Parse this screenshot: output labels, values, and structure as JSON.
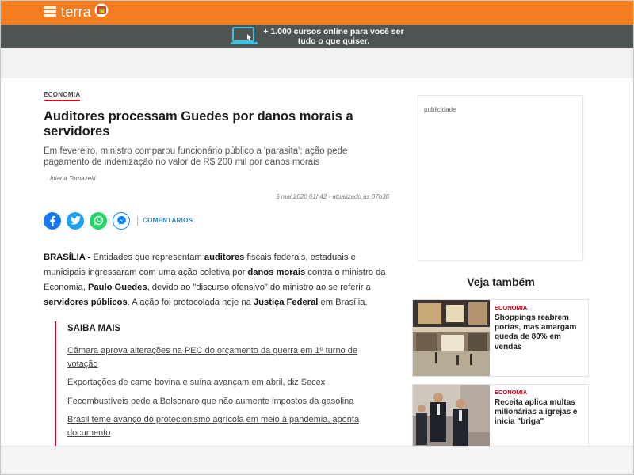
{
  "header": {
    "logo_text": "terra",
    "menu_icon": "hamburger-menu-icon",
    "brand_color": "#f47d20"
  },
  "promo": {
    "icon": "laptop-icon",
    "text_line1": "+ 1.000 cursos online para você ser",
    "text_line2": "tudo o que quiser."
  },
  "article": {
    "section": "ECONOMIA",
    "headline": "Auditores processam Guedes por danos morais a servidores",
    "subtitle": "Em fevereiro, ministro comparou funcionário público a 'parasita'; ação pede pagamento de indenização no valor de R$ 200 mil por danos morais",
    "author": "Idiana Tomazelli",
    "date": "5 mai 2020 01h42 - atualizado às 07h38",
    "share": {
      "facebook_icon": "facebook-icon",
      "twitter_icon": "twitter-icon",
      "whatsapp_icon": "whatsapp-icon",
      "messenger_icon": "messenger-icon",
      "comments_label": "COMENTÁRIOS"
    },
    "body": {
      "p1": "BRASÍLIA - ",
      "p2": "Entidades que representam ",
      "p3": "auditores",
      "p4": " fiscais federais, estaduais e municipais ingressaram com uma ação coletiva por ",
      "p5": "danos morais",
      "p6": " contra o ministro da Economia, ",
      "p7": "Paulo Guedes",
      "p8": ", devido ao \"discurso ofensivo\" do ministro ao se referir a ",
      "p9": "servidores públicos",
      "p10": ". A ação foi protocolada hoje na ",
      "p11": "Justiça Federal",
      "p12": " em Brasília."
    },
    "saiba_mais": {
      "title": "SAIBA MAIS",
      "links": [
        "Câmara aprova alterações na PEC do orçamento da guerra em 1º turno de votação",
        "Exportações de carne bovina e suína avançam em abril, diz Secex",
        "Fecombustíveis pede a Bolsonaro que não aumente impostos da gasolina",
        "Brasil teme avanço do protecionismo agrícola em meio à pandemia, aponta documento"
      ]
    }
  },
  "sidebar": {
    "ad_label": "publicidade",
    "veja_title": "Veja também",
    "cards": [
      {
        "category": "ECONOMIA",
        "title": "Shoppings reabrem portas, mas amargam queda de 80% em vendas"
      },
      {
        "category": "ECONOMIA",
        "title": "Receita aplica multas milionárias a igrejas e inicia \"briga\""
      }
    ]
  },
  "colors": {
    "accent_red": "#d0021b",
    "promo_bg": "#4e5450",
    "link_blue": "#2a7ec5"
  }
}
